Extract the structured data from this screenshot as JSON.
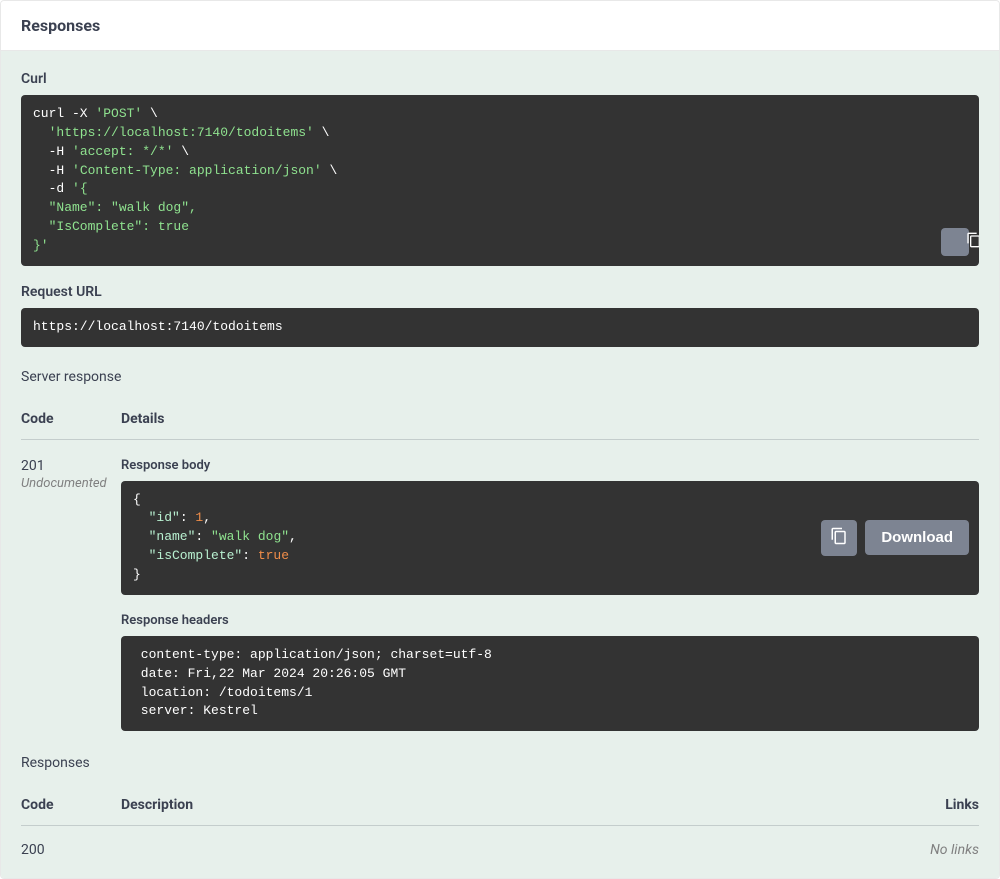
{
  "header": {
    "title": "Responses"
  },
  "curl": {
    "label": "Curl",
    "parts": {
      "l1a": "curl -X ",
      "l1b": "'POST'",
      "l1c": " \\",
      "l2": "  'https://localhost:7140/todoitems'",
      "l2c": " \\",
      "l3a": "  -H ",
      "l3b": "'accept: */*'",
      "l3c": " \\",
      "l4a": "  -H ",
      "l4b": "'Content-Type: application/json'",
      "l4c": " \\",
      "l5a": "  -d ",
      "l5b": "'{",
      "l6": "  \"Name\": \"walk dog\",",
      "l7": "  \"IsComplete\": true",
      "l8": "}'"
    }
  },
  "request_url": {
    "label": "Request URL",
    "value": "https://localhost:7140/todoitems"
  },
  "server_response": {
    "label": "Server response",
    "columns": {
      "code": "Code",
      "details": "Details"
    },
    "row": {
      "code": "201",
      "undocumented": "Undocumented",
      "response_body_label": "Response body",
      "body": {
        "open": "{",
        "k1": "  \"id\"",
        "c1": ": ",
        "v1": "1",
        "comma1": ",",
        "k2": "  \"name\"",
        "c2": ": ",
        "v2": "\"walk dog\"",
        "comma2": ",",
        "k3": "  \"isComplete\"",
        "c3": ": ",
        "v3": "true",
        "close": "}"
      },
      "download_label": "Download",
      "response_headers_label": "Response headers",
      "headers_text": " content-type: application/json; charset=utf-8 \n date: Fri,22 Mar 2024 20:26:05 GMT \n location: /todoitems/1 \n server: Kestrel "
    }
  },
  "responses_section": {
    "label": "Responses",
    "columns": {
      "code": "Code",
      "description": "Description",
      "links": "Links"
    },
    "rows": [
      {
        "code": "200",
        "description": "",
        "links": "No links"
      }
    ]
  }
}
